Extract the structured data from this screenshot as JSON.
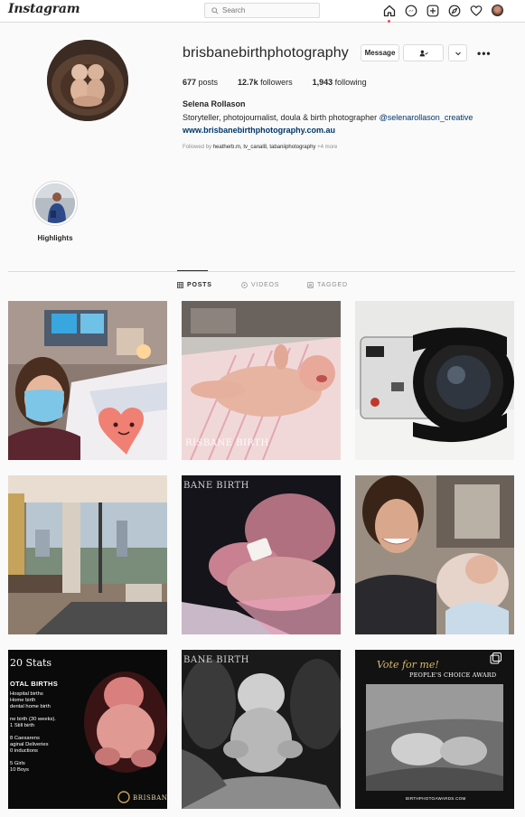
{
  "topbar": {
    "logo": "Instagram",
    "search_placeholder": "Search"
  },
  "profile": {
    "username": "brisbanebirthphotography",
    "message_label": "Message",
    "more_label": "•••",
    "posts_count": "677",
    "posts_label": " posts",
    "followers_count": "12.7k",
    "followers_label": " followers",
    "following_count": "1,943",
    "following_label": " following",
    "full_name": "Selena Rollason",
    "bio": "Storyteller, photojournalist, doula & birth photographer ",
    "bio_mention": "@selenarollason_creative",
    "website": "www.brisbanebirthphotography.com.au",
    "followed_by_label": "Followed by ",
    "followed_by_users": "heatherb.m, tv_canal8, tabaniiphotography",
    "followed_by_more": " +4 more"
  },
  "highlights": [
    {
      "label": "Highlights"
    }
  ],
  "tabs": [
    {
      "label": "POSTS",
      "active": true
    },
    {
      "label": "VIDEOS",
      "active": false
    },
    {
      "label": "TAGGED",
      "active": false
    }
  ],
  "posts": {
    "p2_watermark": "RISBANE BIRTH",
    "p5_watermark": "BANE BIRTH",
    "p7_title": "20 Stats",
    "p7_heading": "OTAL BIRTHS",
    "p7_lines": [
      "Hospital births",
      "Home birth",
      "dental home birth",
      "",
      "ne birth (30 weeks).",
      "1 Still birth",
      "",
      "8 Caesarens",
      "aginal Deliveries",
      "0 inductions",
      "",
      "5 Girls",
      "10 Boys"
    ],
    "p7_brand": "BRISBANE",
    "p8_watermark": "BANE BIRTH",
    "p9_vote": "Vote for me!",
    "p9_award": "PEOPLE'S CHOICE AWARD",
    "p9_footer": "BIRTHPHOTOAWARDS.COM"
  },
  "colors": {
    "accent_link": "#00376b",
    "notification_dot": "#ed4956",
    "border": "#dbdbdb",
    "muted": "#8e8e8e"
  },
  "icons": [
    "search-icon",
    "home-icon",
    "messenger-icon",
    "new-post-icon",
    "explore-icon",
    "heart-icon",
    "person-check-icon",
    "chevron-down-icon",
    "grid-icon",
    "video-icon",
    "tag-icon",
    "multiple-posts-icon"
  ]
}
